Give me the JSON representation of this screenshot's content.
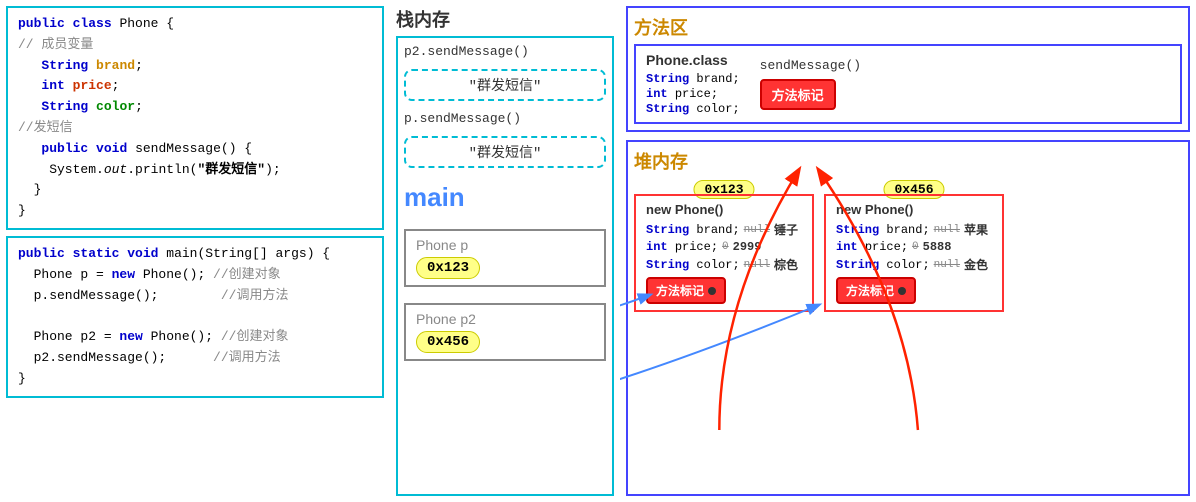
{
  "leftPanel": {
    "class1": {
      "line1": "public class Phone {",
      "comment1": "// 成员变量",
      "field1": "String brand;",
      "field2": "int price;",
      "field3": "String color;",
      "comment2": "//发短信",
      "method1": "public void sendMessage() {",
      "method2": "    System.out.println(\"群发短信\");",
      "method3": "}"
    },
    "class2": {
      "line1": "public static void main(String[] args) {",
      "line2": "  Phone p = new Phone(); //创建对象",
      "line3": "  p.sendMessage();      //调用方法",
      "line4": "  Phone p2 = new Phone(); //创建对象",
      "line5": "  p2.sendMessage();     //调用方法"
    }
  },
  "middlePanel": {
    "title": "栈内存",
    "call1": "p2.sendMessage()",
    "bubble1": "\"群发短信\"",
    "call2": "p.sendMessage()",
    "bubble2": "\"群发短信\"",
    "mainLabel": "main",
    "frame1": {
      "label": "Phone  p",
      "addr": "0x123"
    },
    "frame2": {
      "label": "Phone  p2",
      "addr": "0x456"
    }
  },
  "rightPanel": {
    "methodArea": {
      "title": "方法区",
      "classTitle": "Phone.class",
      "fields": [
        "String brand;",
        "int price;",
        "String color;"
      ],
      "methodName": "sendMessage()",
      "badge": "方法标记"
    },
    "heapArea": {
      "title": "堆内存",
      "obj1": {
        "title": "new Phone()",
        "addr": "0x123",
        "fields": [
          {
            "type": "String brand;",
            "nullVal": "null",
            "realVal": "锤子"
          },
          {
            "type": "int price;",
            "nullVal": "0",
            "realVal": "2999"
          },
          {
            "type": "String color;",
            "nullVal": "null",
            "realVal": "棕色"
          }
        ],
        "badge": "方法标记"
      },
      "obj2": {
        "title": "new Phone()",
        "addr": "0x456",
        "fields": [
          {
            "type": "String brand;",
            "nullVal": "null",
            "realVal": "苹果"
          },
          {
            "type": "int price;",
            "nullVal": "0",
            "realVal": "5888"
          },
          {
            "type": "String color;",
            "nullVal": "null",
            "realVal": "金色"
          }
        ],
        "badge": "方法标记"
      }
    }
  }
}
